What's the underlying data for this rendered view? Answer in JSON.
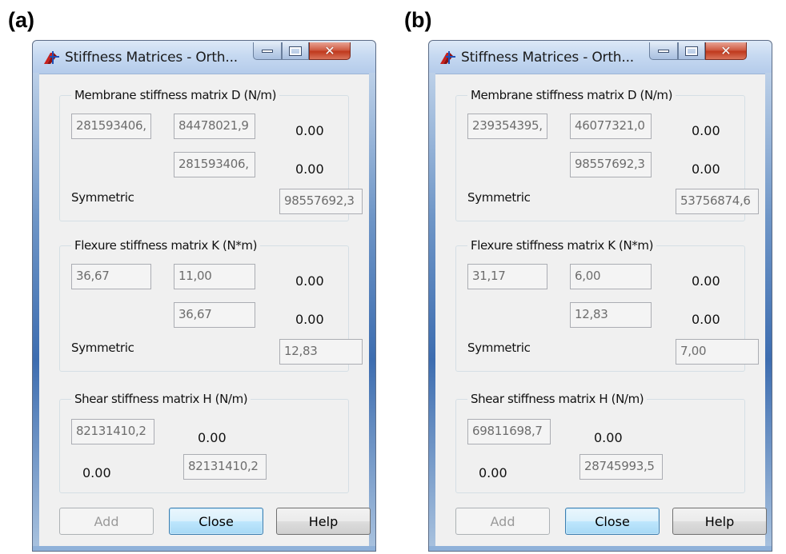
{
  "panels": [
    {
      "label": "(a)",
      "window_title": "Stiffness Matrices - Orth...",
      "membrane": {
        "title": "Membrane stiffness matrix D (N/m)",
        "d11": "281593406,",
        "d12": "84478021,9",
        "d13": "0.00",
        "d22": "281593406,",
        "d23": "0.00",
        "symmetric": "Symmetric",
        "d33": "98557692,3"
      },
      "flexure": {
        "title": "Flexure stiffness matrix K (N*m)",
        "k11": "36,67",
        "k12": "11,00",
        "k13": "0.00",
        "k22": "36,67",
        "k23": "0.00",
        "symmetric": "Symmetric",
        "k33": "12,83"
      },
      "shear": {
        "title": "Shear stiffness matrix H (N/m)",
        "h11": "82131410,2",
        "h12": "0.00",
        "h21": "0.00",
        "h22": "82131410,2"
      },
      "buttons": {
        "add": "Add",
        "close": "Close",
        "help": "Help"
      }
    },
    {
      "label": "(b)",
      "window_title": "Stiffness Matrices - Orth...",
      "membrane": {
        "title": "Membrane stiffness matrix D (N/m)",
        "d11": "239354395,",
        "d12": "46077321,0",
        "d13": "0.00",
        "d22": "98557692,3",
        "d23": "0.00",
        "symmetric": "Symmetric",
        "d33": "53756874,6"
      },
      "flexure": {
        "title": "Flexure stiffness matrix K (N*m)",
        "k11": "31,17",
        "k12": "6,00",
        "k13": "0.00",
        "k22": "12,83",
        "k23": "0.00",
        "symmetric": "Symmetric",
        "k33": "7,00"
      },
      "shear": {
        "title": "Shear stiffness matrix H (N/m)",
        "h11": "69811698,7",
        "h12": "0.00",
        "h21": "0.00",
        "h22": "28745993,5"
      },
      "buttons": {
        "add": "Add",
        "close": "Close",
        "help": "Help"
      }
    }
  ],
  "icons": {
    "app": "matrix-app-icon",
    "minimize": "minimize-icon",
    "maximize": "maximize-icon",
    "close": "close-icon"
  },
  "colors": {
    "close_button": "#c0391d",
    "titlebar": "#c6d9f1",
    "focused_button_border": "#3c7fb1"
  }
}
